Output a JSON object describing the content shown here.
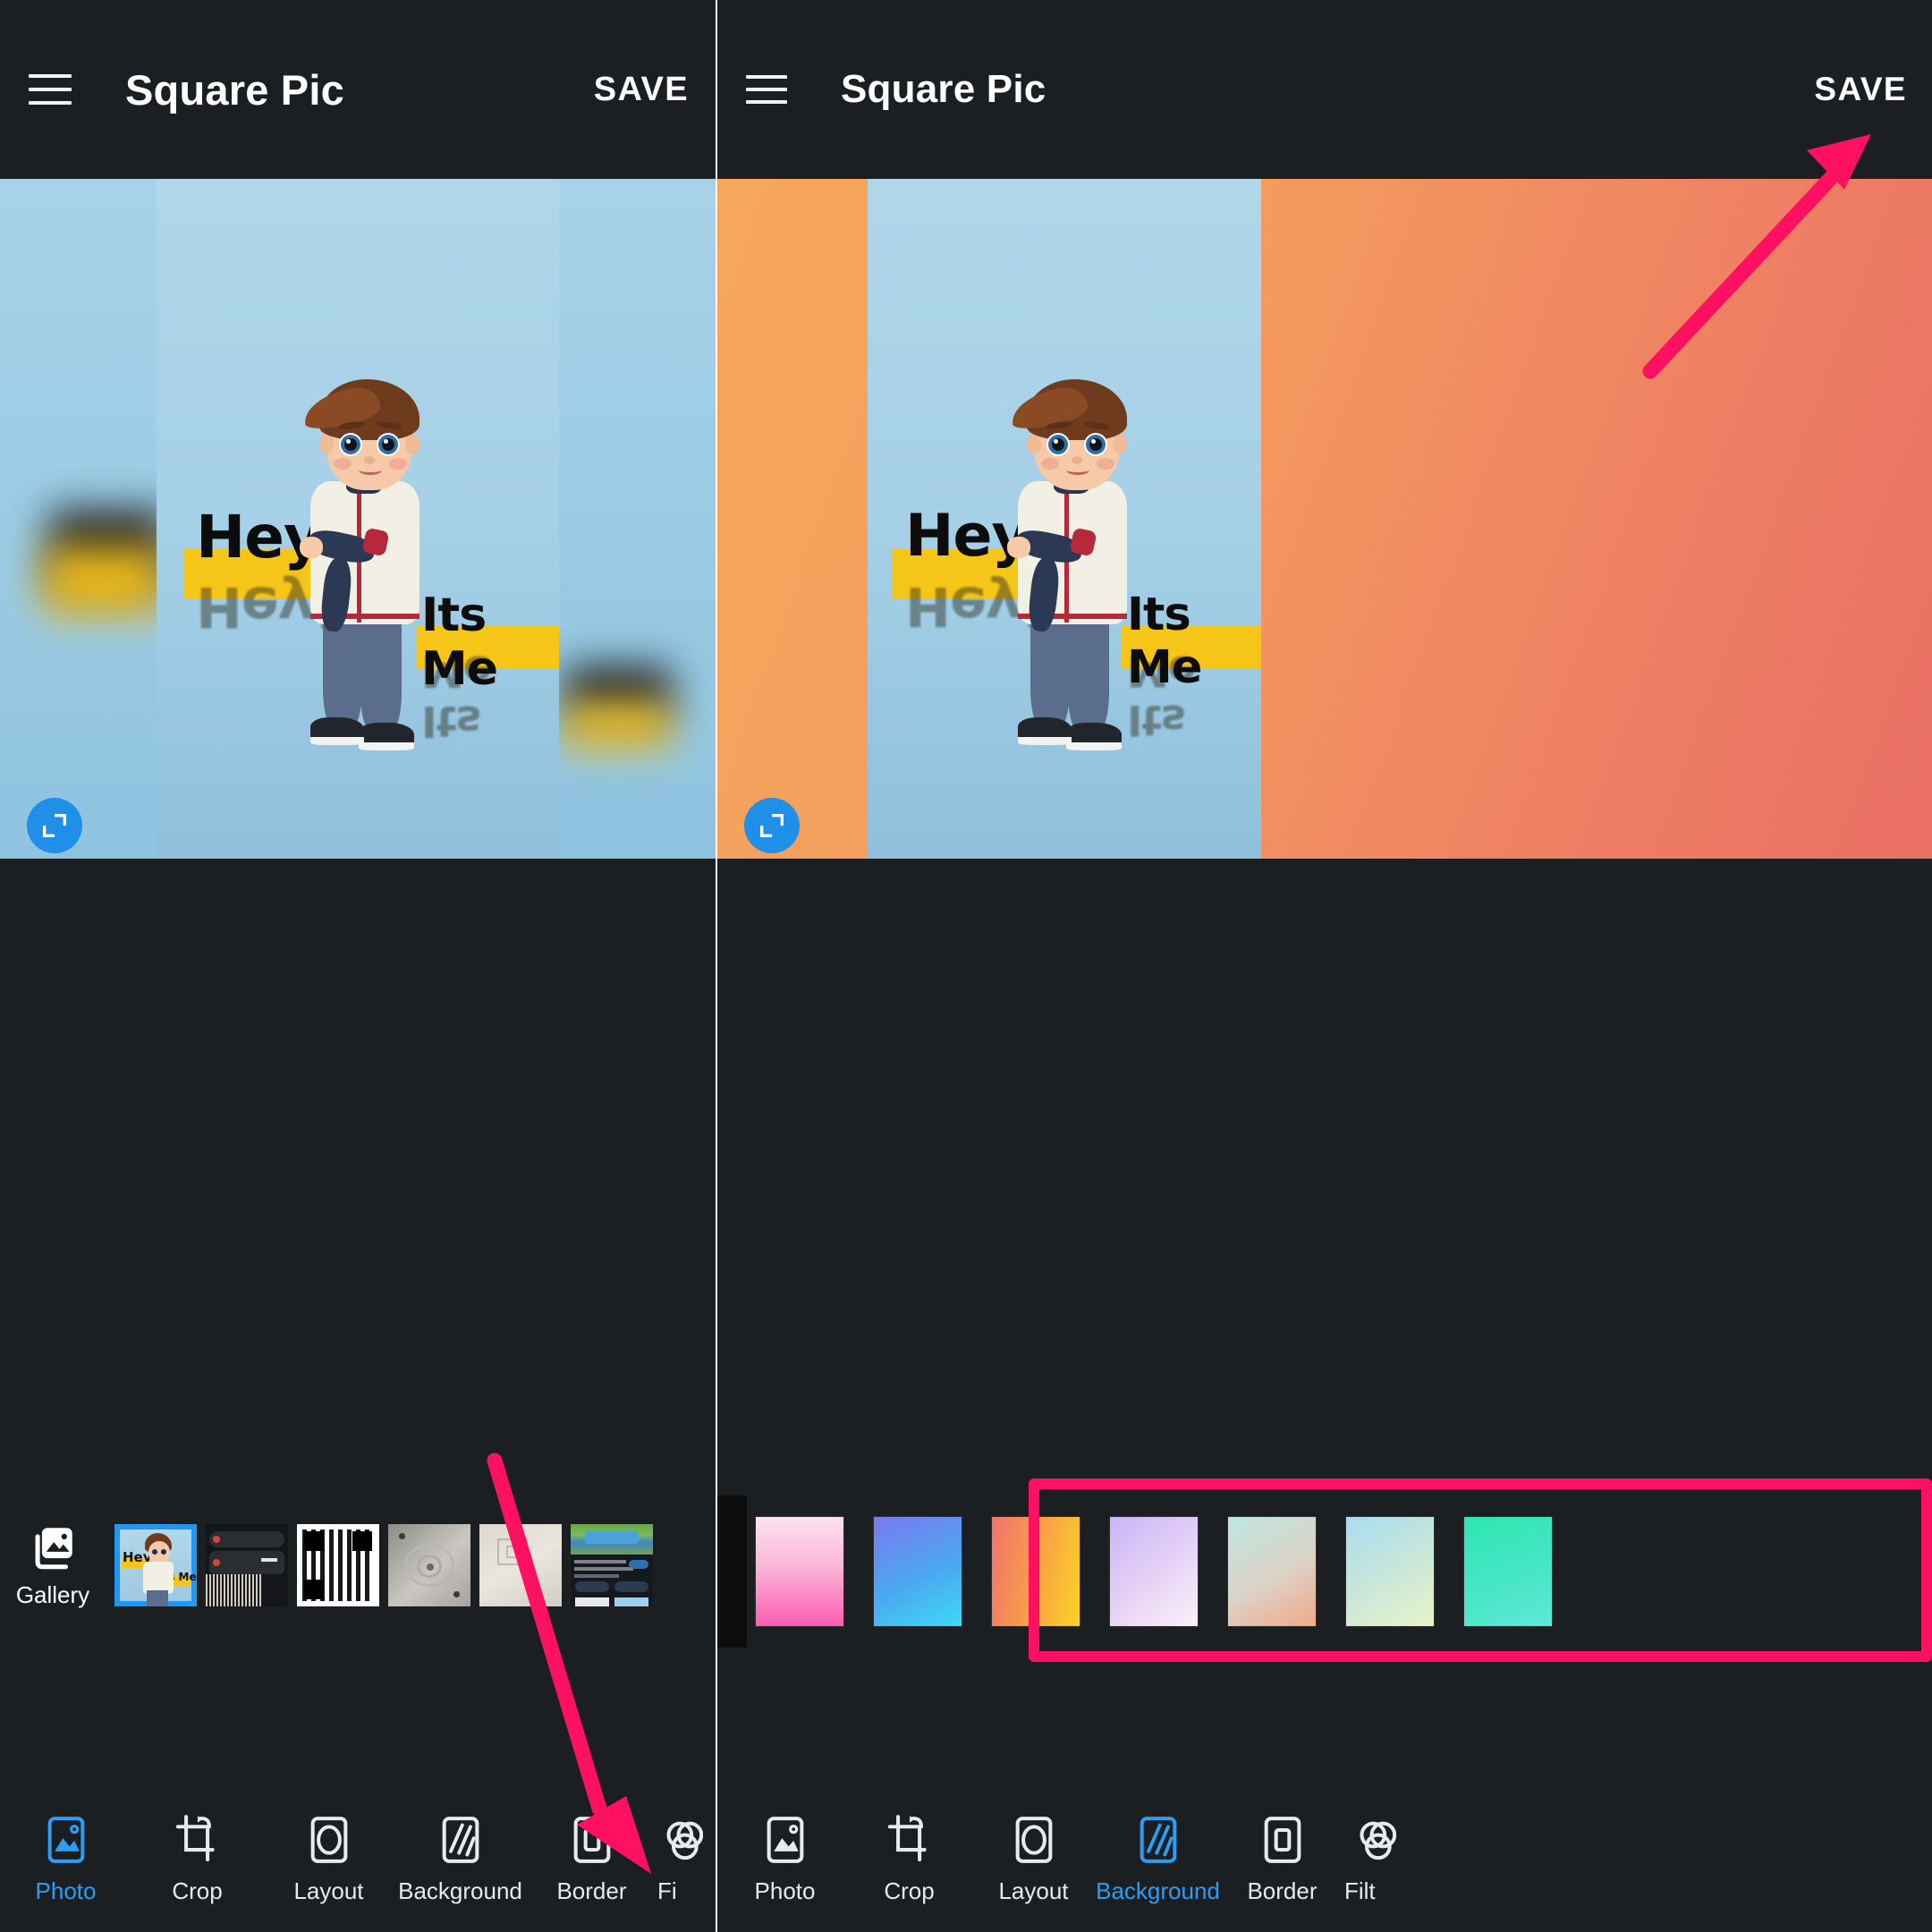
{
  "app": {
    "title": "Square Pic",
    "save_label": "SAVE",
    "menu_icon": "hamburger-menu-icon"
  },
  "left_panel": {
    "appbar": {
      "title": "Square Pic",
      "save_label": "SAVE"
    },
    "canvas": {
      "background_mode": "blur",
      "photo_background": "#a6d0e7",
      "overlay_texts": [
        {
          "text": "Hey!",
          "highlight_color": "#f5c518",
          "text_color": "#0c0c0c"
        },
        {
          "text": "Its Me",
          "highlight_color": "#f5c518",
          "text_color": "#0c0c0c"
        }
      ],
      "expand_button": "expand-icon"
    },
    "gallery": {
      "button_label": "Gallery",
      "button_icon": "gallery-icon",
      "thumbnails": [
        {
          "name": "boy-hey-its-me",
          "selected": true
        },
        {
          "name": "dark-audio-screenshot",
          "selected": false
        },
        {
          "name": "qr-code",
          "selected": false
        },
        {
          "name": "ceiling-fixture-photo",
          "selected": false
        },
        {
          "name": "paper-texture-photo",
          "selected": false
        },
        {
          "name": "social-post-screenshot",
          "selected": false
        }
      ]
    },
    "toolbar": {
      "items": [
        {
          "label": "Photo",
          "icon": "photo-icon",
          "active": true
        },
        {
          "label": "Crop",
          "icon": "crop-icon",
          "active": false
        },
        {
          "label": "Layout",
          "icon": "layout-icon",
          "active": false
        },
        {
          "label": "Background",
          "icon": "background-icon",
          "active": false
        },
        {
          "label": "Border",
          "icon": "border-icon",
          "active": false
        },
        {
          "label": "Fi",
          "icon": "filter-icon",
          "active": false
        }
      ]
    }
  },
  "right_panel": {
    "appbar": {
      "title": "Square Pic",
      "save_label": "SAVE"
    },
    "canvas": {
      "background_mode": "gradient",
      "background_gradient": [
        "#f5a85c",
        "#ea6f64"
      ],
      "photo_background": "#a6d0e7",
      "overlay_texts": [
        {
          "text": "Hey!",
          "highlight_color": "#f5c518",
          "text_color": "#0c0c0c"
        },
        {
          "text": "Its Me",
          "highlight_color": "#f5c518",
          "text_color": "#0c0c0c"
        }
      ],
      "expand_button": "expand-icon"
    },
    "swatches": [
      {
        "name": "pink-gradient",
        "from": "#fbe3f0",
        "to": "#fb5eb0"
      },
      {
        "name": "blue-violet-gradient",
        "from": "#7b79f0",
        "to": "#3fd8f5"
      },
      {
        "name": "sunset-gradient",
        "from": "#f2736f",
        "to": "#fbd424"
      },
      {
        "name": "lavender-gradient",
        "from": "#c9b5f5",
        "to": "#fdf0f7"
      },
      {
        "name": "mint-peach-gradient",
        "from": "#bfe6e0",
        "to": "#f2a987"
      },
      {
        "name": "aqua-lime-gradient",
        "from": "#a9dcf0",
        "to": "#e8f3c8"
      },
      {
        "name": "teal-gradient",
        "from": "#2ee6b0",
        "to": "#5ee8d8"
      }
    ],
    "toolbar": {
      "items": [
        {
          "label": "Photo",
          "icon": "photo-icon",
          "active": false
        },
        {
          "label": "Crop",
          "icon": "crop-icon",
          "active": false
        },
        {
          "label": "Layout",
          "icon": "layout-icon",
          "active": false
        },
        {
          "label": "Background",
          "icon": "background-icon",
          "active": true
        },
        {
          "label": "Border",
          "icon": "border-icon",
          "active": false
        },
        {
          "label": "Filt",
          "icon": "filter-icon",
          "active": false
        }
      ]
    }
  },
  "annotations": {
    "color": "#ff1060",
    "arrow_to_save": "arrow-icon",
    "arrow_to_background": "arrow-icon",
    "highlight_box": "swatch-strip-highlight-box"
  }
}
